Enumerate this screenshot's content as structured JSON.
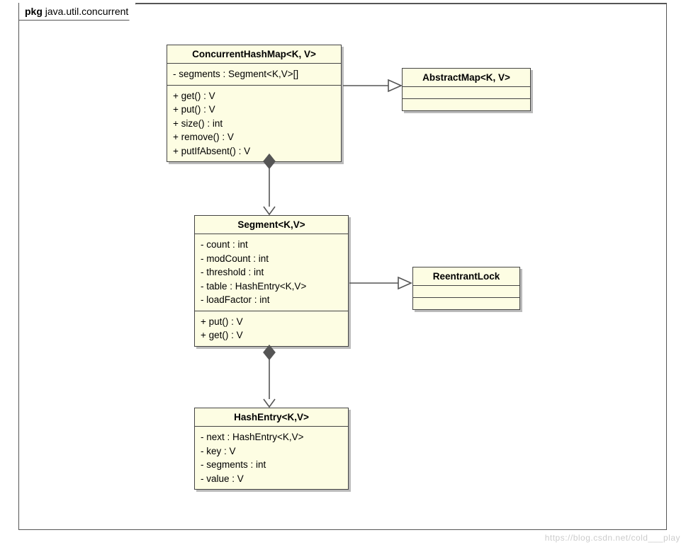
{
  "package": {
    "prefix": "pkg",
    "name": "java.util.concurrent"
  },
  "classes": {
    "concurrentHashMap": {
      "name": "ConcurrentHashMap<K, V>",
      "attrs": [
        "- segments : Segment<K,V>[]"
      ],
      "ops": [
        "+ get() : V",
        "+ put() : V",
        "+ size() : int",
        "+ remove() : V",
        "+ putIfAbsent() : V"
      ]
    },
    "abstractMap": {
      "name": "AbstractMap<K, V>",
      "attrs": [],
      "ops": []
    },
    "segment": {
      "name": "Segment<K,V>",
      "attrs": [
        "- count : int",
        "- modCount : int",
        "- threshold : int",
        "- table : HashEntry<K,V>",
        "- loadFactor : int"
      ],
      "ops": [
        "+ put() : V",
        "+ get() : V"
      ]
    },
    "reentrantLock": {
      "name": "ReentrantLock",
      "attrs": [],
      "ops": []
    },
    "hashEntry": {
      "name": "HashEntry<K,V>",
      "attrs": [
        "- next : HashEntry<K,V>",
        "- key : V",
        "- segments : int",
        "- value : V"
      ],
      "ops": []
    }
  },
  "watermark": "https://blog.csdn.net/cold___play"
}
